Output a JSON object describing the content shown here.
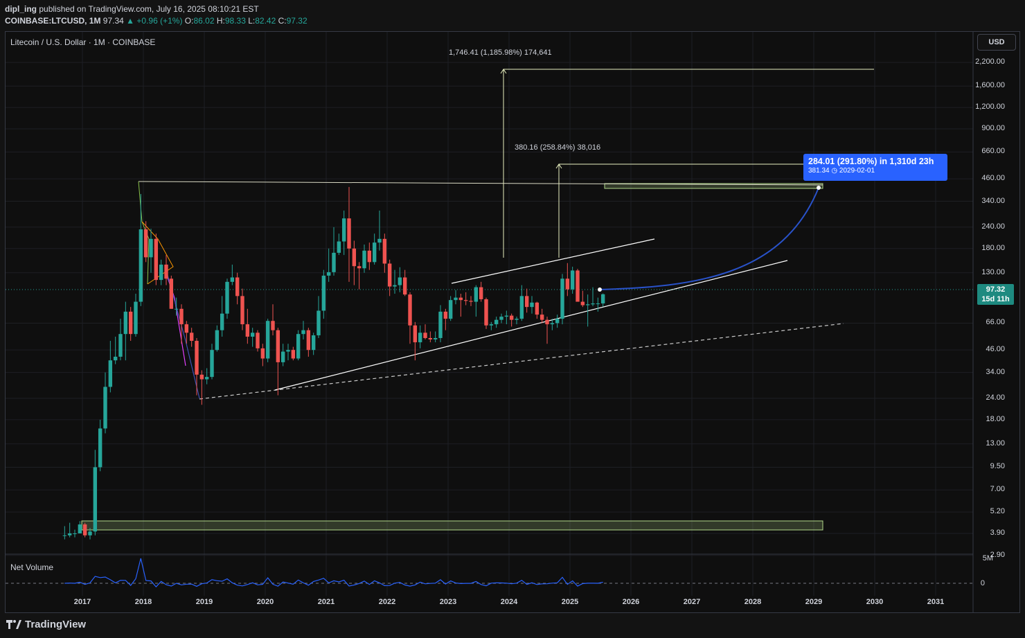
{
  "header": {
    "user": "dipl_ing",
    "published": "published on TradingView.com, July 16, 2025 08:10:21 EST",
    "symbol": "COINBASE:LTCUSD, 1M",
    "last": "97.34",
    "change": "+0.96 (+1%)",
    "o_label": "O:",
    "o": "86.02",
    "h_label": "H:",
    "h": "98.33",
    "l_label": "L:",
    "l": "82.42",
    "c_label": "C:",
    "c": "97.32"
  },
  "legend_title": "Litecoin / U.S. Dollar · 1M · COINBASE",
  "currency_button": "USD",
  "price_badge": {
    "price": "97.32",
    "countdown": "15d 11h"
  },
  "measure": {
    "line1": "284.01 (291.80%) in 1,310d 23h",
    "line2": "381.34",
    "line2_date": "2029-02-01"
  },
  "annotations": {
    "target1": "1,746.41 (1,185.98%) 174,641",
    "target2": "380.16 (258.84%) 38,016"
  },
  "net_volume": {
    "label": "Net Volume",
    "top_tick": "5M",
    "zero_tick": "0"
  },
  "footer": {
    "logo": "TradingView"
  },
  "colors": {
    "up": "#26a69a",
    "down": "#ef5350",
    "accent": "#2962ff",
    "zone": "#b2d88a"
  },
  "chart_data": {
    "type": "candlestick",
    "title": "Litecoin / U.S. Dollar",
    "interval": "1M",
    "y_scale": "log",
    "y_ticks": [
      "2,200.00",
      "1,600.00",
      "1,200.00",
      "900.00",
      "660.00",
      "460.00",
      "340.00",
      "240.00",
      "180.00",
      "130.00",
      "66.00",
      "46.00",
      "34.00",
      "24.00",
      "18.00",
      "13.00",
      "9.50",
      "7.00",
      "5.20",
      "3.90",
      "2.90"
    ],
    "x_ticks": [
      "2017",
      "2018",
      "2019",
      "2020",
      "2021",
      "2022",
      "2023",
      "2024",
      "2025",
      "2026",
      "2027",
      "2028",
      "2029",
      "2030",
      "2031"
    ],
    "ohlc": [
      {
        "t": "2016-09",
        "o": 3.8,
        "h": 4.3,
        "l": 3.6,
        "c": 3.8
      },
      {
        "t": "2016-10",
        "o": 3.8,
        "h": 4.5,
        "l": 3.7,
        "c": 3.9
      },
      {
        "t": "2016-11",
        "o": 3.9,
        "h": 4.1,
        "l": 3.7,
        "c": 3.9
      },
      {
        "t": "2016-12",
        "o": 3.9,
        "h": 4.6,
        "l": 3.9,
        "c": 4.4
      },
      {
        "t": "2017-01",
        "o": 4.4,
        "h": 4.5,
        "l": 3.7,
        "c": 3.8
      },
      {
        "t": "2017-02",
        "o": 3.8,
        "h": 4.2,
        "l": 3.6,
        "c": 4.0
      },
      {
        "t": "2017-03",
        "o": 4.0,
        "h": 12,
        "l": 3.8,
        "c": 9.5
      },
      {
        "t": "2017-04",
        "o": 9.5,
        "h": 18,
        "l": 9,
        "c": 16
      },
      {
        "t": "2017-05",
        "o": 16,
        "h": 34,
        "l": 15,
        "c": 28
      },
      {
        "t": "2017-06",
        "o": 28,
        "h": 52,
        "l": 26,
        "c": 40
      },
      {
        "t": "2017-07",
        "o": 40,
        "h": 55,
        "l": 38,
        "c": 42
      },
      {
        "t": "2017-08",
        "o": 42,
        "h": 70,
        "l": 40,
        "c": 57
      },
      {
        "t": "2017-09",
        "o": 57,
        "h": 88,
        "l": 40,
        "c": 77
      },
      {
        "t": "2017-10",
        "o": 77,
        "h": 82,
        "l": 52,
        "c": 57
      },
      {
        "t": "2017-11",
        "o": 57,
        "h": 98,
        "l": 55,
        "c": 88
      },
      {
        "t": "2017-12",
        "o": 88,
        "h": 375,
        "l": 83,
        "c": 233
      },
      {
        "t": "2018-01",
        "o": 233,
        "h": 260,
        "l": 150,
        "c": 160
      },
      {
        "t": "2018-02",
        "o": 160,
        "h": 235,
        "l": 130,
        "c": 205
      },
      {
        "t": "2018-03",
        "o": 205,
        "h": 220,
        "l": 110,
        "c": 118
      },
      {
        "t": "2018-04",
        "o": 118,
        "h": 155,
        "l": 110,
        "c": 145
      },
      {
        "t": "2018-05",
        "o": 145,
        "h": 165,
        "l": 110,
        "c": 120
      },
      {
        "t": "2018-06",
        "o": 120,
        "h": 125,
        "l": 80,
        "c": 80
      },
      {
        "t": "2018-07",
        "o": 80,
        "h": 93,
        "l": 73,
        "c": 80
      },
      {
        "t": "2018-08",
        "o": 80,
        "h": 85,
        "l": 50,
        "c": 65
      },
      {
        "t": "2018-09",
        "o": 65,
        "h": 68,
        "l": 50,
        "c": 58
      },
      {
        "t": "2018-10",
        "o": 58,
        "h": 62,
        "l": 48,
        "c": 52
      },
      {
        "t": "2018-11",
        "o": 52,
        "h": 54,
        "l": 25,
        "c": 33
      },
      {
        "t": "2018-12",
        "o": 33,
        "h": 35,
        "l": 22,
        "c": 31
      },
      {
        "t": "2019-01",
        "o": 31,
        "h": 36,
        "l": 29,
        "c": 32
      },
      {
        "t": "2019-02",
        "o": 32,
        "h": 50,
        "l": 31,
        "c": 46
      },
      {
        "t": "2019-03",
        "o": 46,
        "h": 64,
        "l": 45,
        "c": 60
      },
      {
        "t": "2019-04",
        "o": 60,
        "h": 95,
        "l": 55,
        "c": 75
      },
      {
        "t": "2019-05",
        "o": 75,
        "h": 120,
        "l": 70,
        "c": 115
      },
      {
        "t": "2019-06",
        "o": 115,
        "h": 145,
        "l": 110,
        "c": 122
      },
      {
        "t": "2019-07",
        "o": 122,
        "h": 130,
        "l": 85,
        "c": 95
      },
      {
        "t": "2019-08",
        "o": 95,
        "h": 105,
        "l": 60,
        "c": 65
      },
      {
        "t": "2019-09",
        "o": 65,
        "h": 80,
        "l": 50,
        "c": 55
      },
      {
        "t": "2019-10",
        "o": 55,
        "h": 62,
        "l": 48,
        "c": 58
      },
      {
        "t": "2019-11",
        "o": 58,
        "h": 60,
        "l": 45,
        "c": 47
      },
      {
        "t": "2019-12",
        "o": 47,
        "h": 50,
        "l": 37,
        "c": 41
      },
      {
        "t": "2020-01",
        "o": 41,
        "h": 70,
        "l": 39,
        "c": 68
      },
      {
        "t": "2020-02",
        "o": 68,
        "h": 85,
        "l": 56,
        "c": 60
      },
      {
        "t": "2020-03",
        "o": 60,
        "h": 62,
        "l": 25,
        "c": 39
      },
      {
        "t": "2020-04",
        "o": 39,
        "h": 50,
        "l": 37,
        "c": 45
      },
      {
        "t": "2020-05",
        "o": 45,
        "h": 50,
        "l": 40,
        "c": 46
      },
      {
        "t": "2020-06",
        "o": 46,
        "h": 48,
        "l": 40,
        "c": 41
      },
      {
        "t": "2020-07",
        "o": 41,
        "h": 60,
        "l": 40,
        "c": 57
      },
      {
        "t": "2020-08",
        "o": 57,
        "h": 68,
        "l": 53,
        "c": 60
      },
      {
        "t": "2020-09",
        "o": 60,
        "h": 62,
        "l": 42,
        "c": 46
      },
      {
        "t": "2020-10",
        "o": 46,
        "h": 58,
        "l": 43,
        "c": 56
      },
      {
        "t": "2020-11",
        "o": 56,
        "h": 95,
        "l": 54,
        "c": 78
      },
      {
        "t": "2020-12",
        "o": 78,
        "h": 135,
        "l": 70,
        "c": 125
      },
      {
        "t": "2021-01",
        "o": 125,
        "h": 180,
        "l": 115,
        "c": 131
      },
      {
        "t": "2021-02",
        "o": 131,
        "h": 240,
        "l": 125,
        "c": 170
      },
      {
        "t": "2021-03",
        "o": 170,
        "h": 220,
        "l": 165,
        "c": 198
      },
      {
        "t": "2021-04",
        "o": 198,
        "h": 300,
        "l": 165,
        "c": 270
      },
      {
        "t": "2021-05",
        "o": 270,
        "h": 412,
        "l": 115,
        "c": 180
      },
      {
        "t": "2021-06",
        "o": 180,
        "h": 200,
        "l": 110,
        "c": 142
      },
      {
        "t": "2021-07",
        "o": 142,
        "h": 150,
        "l": 104,
        "c": 138
      },
      {
        "t": "2021-08",
        "o": 138,
        "h": 190,
        "l": 130,
        "c": 175
      },
      {
        "t": "2021-09",
        "o": 175,
        "h": 195,
        "l": 135,
        "c": 150
      },
      {
        "t": "2021-10",
        "o": 150,
        "h": 220,
        "l": 145,
        "c": 195
      },
      {
        "t": "2021-11",
        "o": 195,
        "h": 300,
        "l": 175,
        "c": 205
      },
      {
        "t": "2021-12",
        "o": 205,
        "h": 220,
        "l": 130,
        "c": 147
      },
      {
        "t": "2022-01",
        "o": 147,
        "h": 155,
        "l": 95,
        "c": 108
      },
      {
        "t": "2022-02",
        "o": 108,
        "h": 135,
        "l": 98,
        "c": 110
      },
      {
        "t": "2022-03",
        "o": 110,
        "h": 140,
        "l": 100,
        "c": 122
      },
      {
        "t": "2022-04",
        "o": 122,
        "h": 135,
        "l": 95,
        "c": 97
      },
      {
        "t": "2022-05",
        "o": 97,
        "h": 100,
        "l": 50,
        "c": 64
      },
      {
        "t": "2022-06",
        "o": 64,
        "h": 67,
        "l": 40,
        "c": 51
      },
      {
        "t": "2022-07",
        "o": 51,
        "h": 64,
        "l": 47,
        "c": 58
      },
      {
        "t": "2022-08",
        "o": 58,
        "h": 65,
        "l": 53,
        "c": 54
      },
      {
        "t": "2022-09",
        "o": 54,
        "h": 59,
        "l": 51,
        "c": 53
      },
      {
        "t": "2022-10",
        "o": 53,
        "h": 59,
        "l": 51,
        "c": 54
      },
      {
        "t": "2022-11",
        "o": 54,
        "h": 84,
        "l": 51,
        "c": 77
      },
      {
        "t": "2022-12",
        "o": 77,
        "h": 80,
        "l": 60,
        "c": 70
      },
      {
        "t": "2023-01",
        "o": 70,
        "h": 95,
        "l": 68,
        "c": 90
      },
      {
        "t": "2023-02",
        "o": 90,
        "h": 103,
        "l": 85,
        "c": 93
      },
      {
        "t": "2023-03",
        "o": 93,
        "h": 98,
        "l": 72,
        "c": 90
      },
      {
        "t": "2023-04",
        "o": 90,
        "h": 100,
        "l": 84,
        "c": 89
      },
      {
        "t": "2023-05",
        "o": 89,
        "h": 95,
        "l": 83,
        "c": 88
      },
      {
        "t": "2023-06",
        "o": 88,
        "h": 110,
        "l": 72,
        "c": 107
      },
      {
        "t": "2023-07",
        "o": 107,
        "h": 115,
        "l": 88,
        "c": 91
      },
      {
        "t": "2023-08",
        "o": 91,
        "h": 93,
        "l": 61,
        "c": 64
      },
      {
        "t": "2023-09",
        "o": 64,
        "h": 67,
        "l": 60,
        "c": 65
      },
      {
        "t": "2023-10",
        "o": 65,
        "h": 72,
        "l": 62,
        "c": 69
      },
      {
        "t": "2023-11",
        "o": 69,
        "h": 75,
        "l": 66,
        "c": 72
      },
      {
        "t": "2023-12",
        "o": 72,
        "h": 78,
        "l": 65,
        "c": 73
      },
      {
        "t": "2024-01",
        "o": 73,
        "h": 75,
        "l": 63,
        "c": 69
      },
      {
        "t": "2024-02",
        "o": 69,
        "h": 72,
        "l": 65,
        "c": 70
      },
      {
        "t": "2024-03",
        "o": 70,
        "h": 110,
        "l": 68,
        "c": 95
      },
      {
        "t": "2024-04",
        "o": 95,
        "h": 105,
        "l": 76,
        "c": 82
      },
      {
        "t": "2024-05",
        "o": 82,
        "h": 95,
        "l": 75,
        "c": 87
      },
      {
        "t": "2024-06",
        "o": 87,
        "h": 88,
        "l": 70,
        "c": 74
      },
      {
        "t": "2024-07",
        "o": 74,
        "h": 80,
        "l": 66,
        "c": 69
      },
      {
        "t": "2024-08",
        "o": 69,
        "h": 72,
        "l": 50,
        "c": 65
      },
      {
        "t": "2024-09",
        "o": 65,
        "h": 70,
        "l": 60,
        "c": 66
      },
      {
        "t": "2024-10",
        "o": 66,
        "h": 74,
        "l": 62,
        "c": 70
      },
      {
        "t": "2024-11",
        "o": 70,
        "h": 128,
        "l": 65,
        "c": 120
      },
      {
        "t": "2024-12",
        "o": 120,
        "h": 148,
        "l": 95,
        "c": 104
      },
      {
        "t": "2025-01",
        "o": 104,
        "h": 141,
        "l": 98,
        "c": 134
      },
      {
        "t": "2025-02",
        "o": 134,
        "h": 137,
        "l": 90,
        "c": 88
      },
      {
        "t": "2025-03",
        "o": 88,
        "h": 102,
        "l": 82,
        "c": 84
      },
      {
        "t": "2025-04",
        "o": 84,
        "h": 97,
        "l": 63,
        "c": 85
      },
      {
        "t": "2025-05",
        "o": 85,
        "h": 107,
        "l": 83,
        "c": 86
      },
      {
        "t": "2025-06",
        "o": 86,
        "h": 93,
        "l": 77,
        "c": 86
      },
      {
        "t": "2025-07",
        "o": 86.02,
        "h": 98.33,
        "l": 82.42,
        "c": 97.32
      }
    ]
  }
}
